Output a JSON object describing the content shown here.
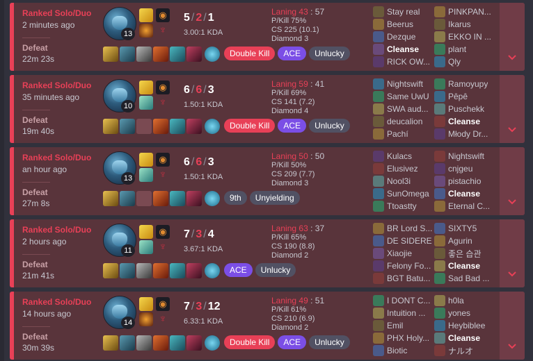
{
  "ui": {
    "kda_suffix": "KDA",
    "cleanse_label": "Cleanse"
  },
  "matches": [
    {
      "queue": "Ranked Solo/Duo",
      "ago": "2 minutes ago",
      "result": "Defeat",
      "duration": "22m 23s",
      "level": "13",
      "kills": "5",
      "deaths": "2",
      "assists": "1",
      "ratio": "3.00:1 KDA",
      "laning_label": "Laning",
      "laning_self": "43",
      "laning_opp": "57",
      "pkill": "P/Kill 75%",
      "cs": "CS 225 (10.1)",
      "rank": "Diamond 3",
      "spells": [
        "flash",
        "ignite"
      ],
      "items_empty": [],
      "badges": [
        {
          "text": "Double Kill",
          "style": "red"
        },
        {
          "text": "ACE",
          "style": "purple"
        },
        {
          "text": "Unlucky",
          "style": "gray"
        }
      ],
      "team1": [
        "Stay real",
        "Beerus",
        "Dezque",
        "Cleanse",
        "RICK OW..."
      ],
      "team2": [
        "PINKPAN...",
        "Ikarus",
        "EKKO IN ...",
        "plant",
        "Qly"
      ]
    },
    {
      "queue": "Ranked Solo/Duo",
      "ago": "35 minutes ago",
      "result": "Defeat",
      "duration": "19m 40s",
      "level": "10",
      "kills": "6",
      "deaths": "6",
      "assists": "3",
      "ratio": "1.50:1 KDA",
      "laning_label": "Laning",
      "laning_self": "59",
      "laning_opp": "41",
      "pkill": "P/Kill 69%",
      "cs": "CS 141 (7.2)",
      "rank": "Diamond 4",
      "spells": [
        "flash",
        "heal"
      ],
      "items_empty": [
        2
      ],
      "badges": [
        {
          "text": "Double Kill",
          "style": "red"
        },
        {
          "text": "ACE",
          "style": "purple"
        },
        {
          "text": "Unlucky",
          "style": "gray"
        }
      ],
      "team1": [
        "Nightswift",
        "Same UwU",
        "SWA aud...",
        "deucalion",
        "Pachí"
      ],
      "team2": [
        "Ramoyupy",
        "Pêpê",
        "Puschekk",
        "Cleanse",
        "Młody Dr..."
      ]
    },
    {
      "queue": "Ranked Solo/Duo",
      "ago": "an hour ago",
      "result": "Defeat",
      "duration": "27m 8s",
      "level": "13",
      "kills": "6",
      "deaths": "6",
      "assists": "3",
      "ratio": "1.50:1 KDA",
      "laning_label": "Laning",
      "laning_self": "50",
      "laning_opp": "50",
      "pkill": "P/Kill 50%",
      "cs": "CS 209 (7.7)",
      "rank": "Diamond 3",
      "spells": [
        "flash",
        "heal"
      ],
      "items_empty": [
        2
      ],
      "badges": [
        {
          "text": "9th",
          "style": "gray"
        },
        {
          "text": "Unyielding",
          "style": "gray"
        }
      ],
      "team1": [
        "Kulacs",
        "Elusivez",
        "Nool3i",
        "SunOmega",
        "Ttoastty"
      ],
      "team2": [
        "Nightswift",
        "cnjgeu",
        "pistachio",
        "Cleanse",
        "Eternal C..."
      ]
    },
    {
      "queue": "Ranked Solo/Duo",
      "ago": "2 hours ago",
      "result": "Defeat",
      "duration": "21m 41s",
      "level": "11",
      "kills": "7",
      "deaths": "3",
      "assists": "4",
      "ratio": "3.67:1 KDA",
      "laning_label": "Laning",
      "laning_self": "63",
      "laning_opp": "37",
      "pkill": "P/Kill 65%",
      "cs": "CS 190 (8.8)",
      "rank": "Diamond 2",
      "spells": [
        "flash",
        "heal"
      ],
      "items_empty": [],
      "badges": [
        {
          "text": "ACE",
          "style": "purple"
        },
        {
          "text": "Unlucky",
          "style": "gray"
        }
      ],
      "team1": [
        "BR Lord S...",
        "DE SIDERE",
        "Xiaojie",
        "Felony Fo...",
        "BGT Batu..."
      ],
      "team2": [
        "SIXTY5",
        "Agurin",
        "좋은 습관",
        "Cleanse",
        "Sad Bad ..."
      ]
    },
    {
      "queue": "Ranked Solo/Duo",
      "ago": "14 hours ago",
      "result": "Defeat",
      "duration": "30m 39s",
      "level": "14",
      "kills": "7",
      "deaths": "3",
      "assists": "12",
      "ratio": "6.33:1 KDA",
      "laning_label": "Laning",
      "laning_self": "49",
      "laning_opp": "51",
      "pkill": "P/Kill 61%",
      "cs": "CS 210 (6.9)",
      "rank": "Diamond 2",
      "spells": [
        "flash",
        "ignite"
      ],
      "items_empty": [],
      "badges": [
        {
          "text": "Double Kill",
          "style": "red"
        },
        {
          "text": "ACE",
          "style": "purple"
        },
        {
          "text": "Unlucky",
          "style": "gray"
        }
      ],
      "team1": [
        "I DONT C...",
        "Intuition ...",
        "Emil",
        "PHX Holy...",
        "Biotic"
      ],
      "team2": [
        "h0la",
        "yones",
        "Heybiblee",
        "Cleanse",
        "ナルオ"
      ]
    }
  ],
  "colors": {
    "loss_bg": "#59343b",
    "loss_accent": "#e84057",
    "badge_red": "#e84057",
    "badge_purple": "#7b4ee6",
    "badge_gray": "#515163"
  },
  "icons": {
    "champion": "champion-portrait-icon",
    "flash": "flash-spell-icon",
    "ignite": "ignite-spell-icon",
    "heal": "heal-spell-icon",
    "keystone": "keystone-rune-icon",
    "secondary": "secondary-rune-icon",
    "ward": "ward-trinket-icon",
    "expand": "chevron-down-icon"
  }
}
